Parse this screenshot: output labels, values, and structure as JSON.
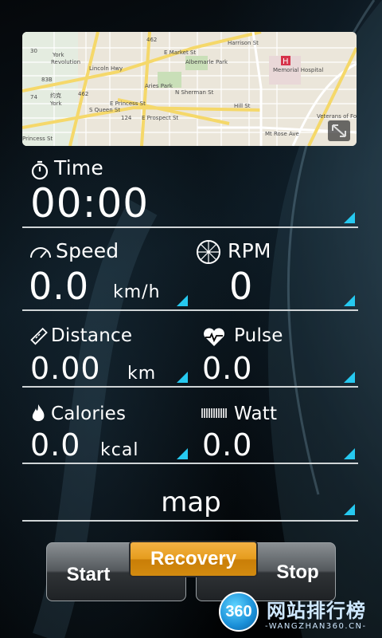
{
  "map": {
    "labels": {
      "york": "York",
      "revolution": "Revolution",
      "lincoln_hwy": "Lincoln Hwy",
      "e_market": "E Market St",
      "albemarle": "Albemarle Park",
      "aries_park": "Aries Park",
      "memorial": "Memorial Hospital",
      "e_princess": "E Princess St",
      "e_prospect": "E Prospect St",
      "mt_rose": "Mt Rose Ave",
      "sherman": "N Sherman St",
      "queen": "S Queen St",
      "hill": "Hill St",
      "harrison": "Harrison St",
      "veterans": "Veterans of Foreign",
      "cn_york": "约克",
      "york2": "York",
      "princess_w": "Princess St",
      "r462": "462",
      "r124": "124",
      "r30": "30",
      "r83b": "83B",
      "r74": "74",
      "hospital_letter": "H"
    }
  },
  "time": {
    "label": "Time",
    "value": "00:00"
  },
  "speed": {
    "label": "Speed",
    "value": "0.0",
    "unit": "km/h"
  },
  "rpm": {
    "label": "RPM",
    "value": "0"
  },
  "distance": {
    "label": "Distance",
    "value": "0.00",
    "unit": "km"
  },
  "pulse": {
    "label": "Pulse",
    "value": "0.0"
  },
  "calories": {
    "label": "Calories",
    "value": "0.0",
    "unit": "kcal"
  },
  "watt": {
    "label": "Watt",
    "value": "0.0"
  },
  "mode": {
    "label": "map"
  },
  "buttons": {
    "start": "Start",
    "recovery": "Recovery",
    "stop": "Stop"
  },
  "watermark": {
    "badge": "360",
    "cn": "网站排行榜",
    "en": "-WANGZHAN360.CN-"
  },
  "colors": {
    "accent": "#26c9f0",
    "recovery": "#e59c1d",
    "divider": "#cfd4d6"
  }
}
